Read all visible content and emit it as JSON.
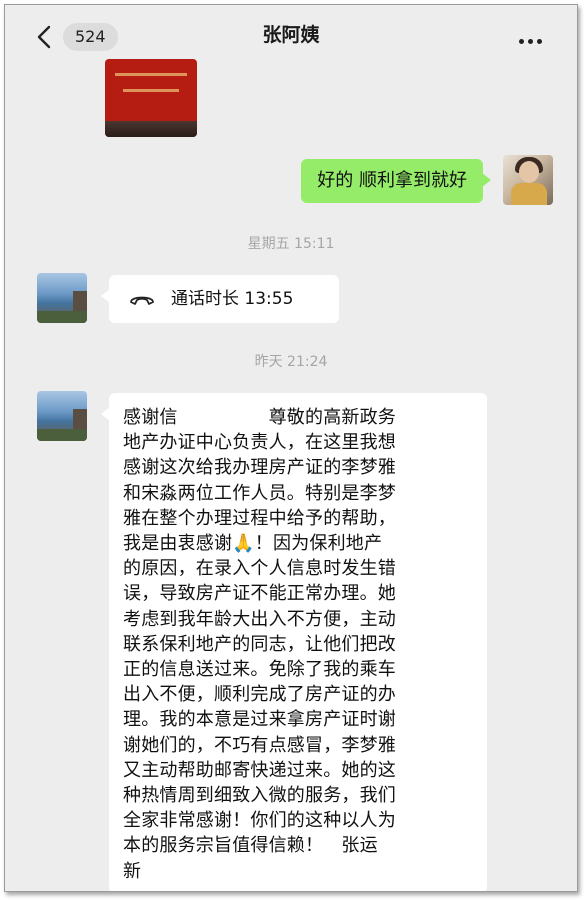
{
  "header": {
    "unread_count": "524",
    "title": "张阿姨"
  },
  "messages": {
    "sent_text": "好的 顺利拿到就好",
    "time_1": "星期五 15:11",
    "call_label": "通话时长 13:55",
    "time_2": "昨天 21:24",
    "letter": "感谢信　　　　　尊敬的高新政务\n地产办证中心负责人，在这里我想\n感谢这次给我办理房产证的李梦雅\n和宋淼两位工作人员。特别是李梦\n雅在整个办理过程中给予的帮助，\n我是由衷感谢🙏！因为保利地产\n的原因，在录入个人信息时发生错\n误，导致房产证不能正常办理。她\n考虑到我年龄大出入不方便，主动\n联系保利地产的同志，让他们把改\n正的信息送过来。免除了我的乘车\n出入不便，顺利完成了房产证的办\n理。我的本意是过来拿房产证时谢\n谢她们的，不巧有点感冒，李梦雅\n又主动帮助邮寄快递过来。她的这\n种热情周到细致入微的服务，我们\n全家非常感谢！你们的这种以人为\n本的服务宗旨值得信赖！　张运\n新"
  },
  "icons": {
    "back": "chevron-left-icon",
    "more": "more-dots-icon",
    "call": "phone-handset-icon"
  },
  "colors": {
    "chat_background": "#ededed",
    "sent_bubble": "#95ec69",
    "received_bubble": "#ffffff",
    "timestamp_text": "#a6a6a6"
  }
}
